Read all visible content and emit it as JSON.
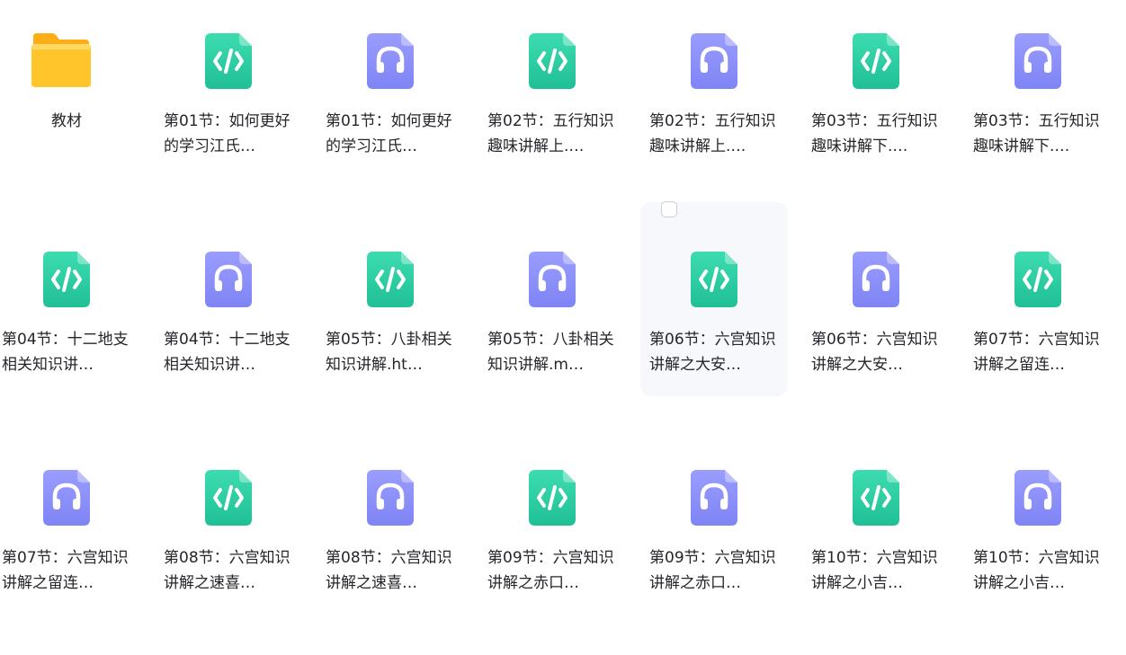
{
  "colors": {
    "code_gradient_top": "#3ddcb0",
    "code_gradient_bottom": "#20bf96",
    "audio_gradient_top": "#9a9dfd",
    "audio_gradient_bottom": "#7f84f5",
    "folder_yellow": "#ffc52a",
    "folder_back": "#ffad14",
    "hover_background": "#f6f8fc"
  },
  "files": [
    {
      "type": "folder",
      "icon": "folder-icon",
      "name": "教材"
    },
    {
      "type": "code",
      "icon": "code-file-icon",
      "name": "第01节：如何更好的学习江氏…"
    },
    {
      "type": "audio",
      "icon": "audio-file-icon",
      "name": "第01节：如何更好的学习江氏…"
    },
    {
      "type": "code",
      "icon": "code-file-icon",
      "name": "第02节：五行知识趣味讲解上.…"
    },
    {
      "type": "audio",
      "icon": "audio-file-icon",
      "name": "第02节：五行知识趣味讲解上.…"
    },
    {
      "type": "code",
      "icon": "code-file-icon",
      "name": "第03节：五行知识趣味讲解下.…"
    },
    {
      "type": "audio",
      "icon": "audio-file-icon",
      "name": "第03节：五行知识趣味讲解下.…"
    },
    {
      "type": "code",
      "icon": "code-file-icon",
      "name": "第04节：十二地支相关知识讲…"
    },
    {
      "type": "audio",
      "icon": "audio-file-icon",
      "name": "第04节：十二地支相关知识讲…"
    },
    {
      "type": "code",
      "icon": "code-file-icon",
      "name": "第05节：八卦相关知识讲解.ht…"
    },
    {
      "type": "audio",
      "icon": "audio-file-icon",
      "name": "第05节：八卦相关知识讲解.m…"
    },
    {
      "type": "code",
      "icon": "code-file-icon",
      "name": "第06节：六宫知识讲解之大安…",
      "hovered": true
    },
    {
      "type": "audio",
      "icon": "audio-file-icon",
      "name": "第06节：六宫知识讲解之大安…"
    },
    {
      "type": "code",
      "icon": "code-file-icon",
      "name": "第07节：六宫知识讲解之留连…"
    },
    {
      "type": "audio",
      "icon": "audio-file-icon",
      "name": "第07节：六宫知识讲解之留连…"
    },
    {
      "type": "code",
      "icon": "code-file-icon",
      "name": "第08节：六宫知识讲解之速喜…"
    },
    {
      "type": "audio",
      "icon": "audio-file-icon",
      "name": "第08节：六宫知识讲解之速喜…"
    },
    {
      "type": "code",
      "icon": "code-file-icon",
      "name": "第09节：六宫知识讲解之赤口…"
    },
    {
      "type": "audio",
      "icon": "audio-file-icon",
      "name": "第09节：六宫知识讲解之赤口…"
    },
    {
      "type": "code",
      "icon": "code-file-icon",
      "name": "第10节：六宫知识讲解之小吉…"
    },
    {
      "type": "audio",
      "icon": "audio-file-icon",
      "name": "第10节：六宫知识讲解之小吉…"
    }
  ]
}
